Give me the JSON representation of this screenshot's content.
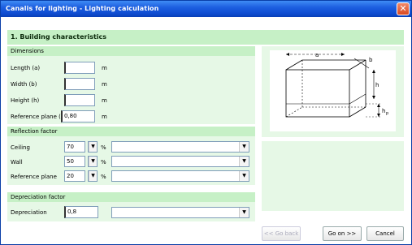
{
  "window": {
    "title": "Canalis for lighting - Lighting calculation",
    "close_glyph": "✕"
  },
  "section": {
    "title": "1. Building characteristics"
  },
  "dimensions": {
    "header": "Dimensions",
    "length_label": "Length (a)",
    "length_value": "",
    "width_label": "Width (b)",
    "width_value": "",
    "height_label": "Height (h)",
    "height_value": "",
    "refplane_label": "Reference plane (",
    "refplane_value": "0,80",
    "unit": "m"
  },
  "reflection": {
    "header": "Reflection factor",
    "ceiling_label": "Ceiling",
    "ceiling_value": "70",
    "wall_label": "Wall",
    "wall_value": "50",
    "refplane_label": "Reference plane",
    "refplane_value": "20",
    "unit": "%",
    "ceiling_desc": "",
    "wall_desc": "",
    "refplane_desc": ""
  },
  "depreciation": {
    "header": "Depreciation factor",
    "label": "Depreciation",
    "value": "0,8",
    "desc": ""
  },
  "diagram": {
    "a_label": "a",
    "b_label": "b",
    "h_label": "h",
    "hp_label": "h",
    "hp_sub": "p"
  },
  "buttons": {
    "back": "<< Go back",
    "next": "Go on >>",
    "cancel": "Cancel"
  },
  "icons": {
    "dropdown": "chevron-down-icon",
    "close": "close-icon"
  }
}
